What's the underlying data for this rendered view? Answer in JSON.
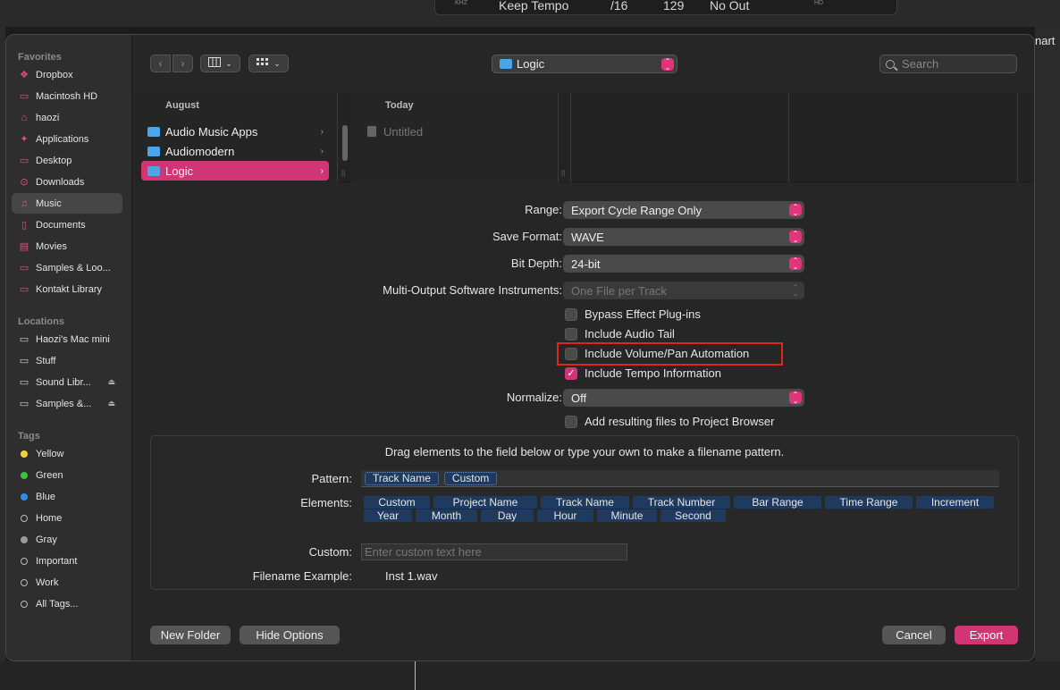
{
  "header_lcd": {
    "khz_label": "KHZ",
    "tempo_mode": "Keep Tempo",
    "division": "/16",
    "tempo": "129",
    "output": "No Out",
    "hd_label": "HD"
  },
  "behind_right_text": "nart",
  "sidebar": {
    "favorites_title": "Favorites",
    "favorites": [
      {
        "label": "Dropbox",
        "icon": "dropbox-icon"
      },
      {
        "label": "Macintosh HD",
        "icon": "drive-icon"
      },
      {
        "label": "haozi",
        "icon": "home-icon"
      },
      {
        "label": "Applications",
        "icon": "applications-icon"
      },
      {
        "label": "Desktop",
        "icon": "desktop-icon"
      },
      {
        "label": "Downloads",
        "icon": "downloads-icon"
      },
      {
        "label": "Music",
        "icon": "music-icon"
      },
      {
        "label": "Documents",
        "icon": "document-icon"
      },
      {
        "label": "Movies",
        "icon": "movies-icon"
      },
      {
        "label": "Samples & Loo...",
        "icon": "folder-icon"
      },
      {
        "label": "Kontakt Library",
        "icon": "folder-icon"
      }
    ],
    "locations_title": "Locations",
    "locations": [
      {
        "label": "Haozi's Mac mini",
        "icon": "computer-icon"
      },
      {
        "label": "Stuff",
        "icon": "drive-icon"
      },
      {
        "label": "Sound Libr...",
        "icon": "drive-icon"
      },
      {
        "label": "Samples &...",
        "icon": "drive-icon"
      }
    ],
    "tags_title": "Tags",
    "tags": [
      {
        "label": "Yellow",
        "color": "#f5d23c"
      },
      {
        "label": "Green",
        "color": "#3cc43c"
      },
      {
        "label": "Blue",
        "color": "#2f8de4"
      },
      {
        "label": "Home",
        "color": ""
      },
      {
        "label": "Gray",
        "color": "#9a9a9a"
      },
      {
        "label": "Important",
        "color": ""
      },
      {
        "label": "Work",
        "color": ""
      },
      {
        "label": "All Tags...",
        "color": ""
      }
    ]
  },
  "toolbar": {
    "back": "‹",
    "forward": "›",
    "location": "Logic",
    "search_placeholder": "Search"
  },
  "browser": {
    "col1_header": "August",
    "col1_items": [
      {
        "label": "Audio Music Apps"
      },
      {
        "label": "Audiomodern"
      },
      {
        "label": "Logic"
      }
    ],
    "col2_header": "Today",
    "col2_items": [
      {
        "label": "Untitled"
      }
    ]
  },
  "options": {
    "range_label": "Range:",
    "range_value": "Export Cycle Range Only",
    "format_label": "Save Format:",
    "format_value": "WAVE",
    "bitdepth_label": "Bit Depth:",
    "bitdepth_value": "24-bit",
    "multi_label": "Multi-Output Software Instruments:",
    "multi_value": "One File per Track",
    "bypass_label": "Bypass Effect Plug-ins",
    "tail_label": "Include Audio Tail",
    "volpan_label": "Include Volume/Pan Automation",
    "tempo_label": "Include Tempo Information",
    "normalize_label": "Normalize:",
    "normalize_value": "Off",
    "browser_label": "Add resulting files to Project Browser"
  },
  "filename": {
    "hint": "Drag elements to the field below or type your own to make a filename pattern.",
    "pattern_label": "Pattern:",
    "pattern_tokens": [
      "Track Name",
      "Custom"
    ],
    "elements_label": "Elements:",
    "elements_row1": [
      "Custom",
      "Project Name",
      "Track Name",
      "Track Number",
      "Bar Range",
      "Time Range",
      "Increment"
    ],
    "elements_row2": [
      "Year",
      "Month",
      "Day",
      "Hour",
      "Minute",
      "Second"
    ],
    "custom_label": "Custom:",
    "custom_placeholder": "Enter custom text here",
    "example_label": "Filename Example:",
    "example_value": "Inst 1.wav"
  },
  "buttons": {
    "new_folder": "New Folder",
    "hide_options": "Hide Options",
    "cancel": "Cancel",
    "export": "Export"
  }
}
